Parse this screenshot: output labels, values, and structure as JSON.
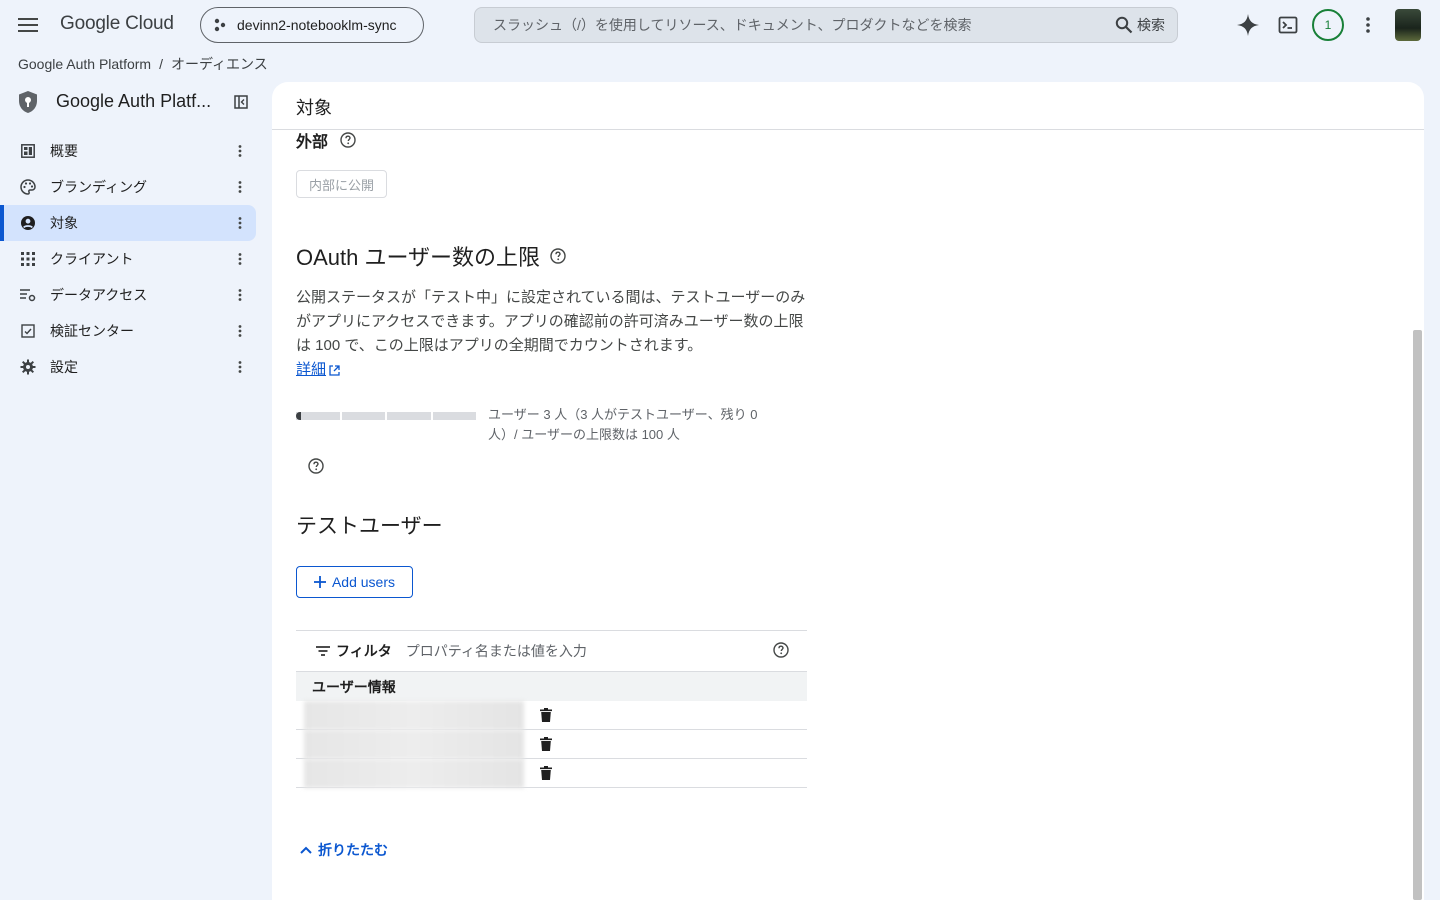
{
  "header": {
    "logo": "Google Cloud",
    "project": "devinn2-notebooklm-sync",
    "search_placeholder": "スラッシュ（/）を使用してリソース、ドキュメント、プロダクトなどを検索",
    "search_button": "検索",
    "notification_count": "1"
  },
  "breadcrumb": {
    "root": "Google Auth Platform",
    "separator": "/",
    "current": "オーディエンス"
  },
  "sidebar": {
    "product_title": "Google Auth Platf...",
    "items": [
      {
        "label": "概要",
        "icon": "dashboard-icon"
      },
      {
        "label": "ブランディング",
        "icon": "palette-icon"
      },
      {
        "label": "対象",
        "icon": "account-circle-icon",
        "active": true
      },
      {
        "label": "クライアント",
        "icon": "apps-grid-icon"
      },
      {
        "label": "データアクセス",
        "icon": "data-access-icon"
      },
      {
        "label": "検証センター",
        "icon": "verification-icon"
      },
      {
        "label": "設定",
        "icon": "gear-icon"
      }
    ]
  },
  "main": {
    "title": "対象",
    "user_type": "外部",
    "publish_button": "内部に公開",
    "oauth_limit": {
      "title": "OAuth ユーザー数の上限",
      "description": "公開ステータスが「テスト中」に設定されている間は、テストユーザーのみがアプリにアクセスできます。アプリの確認前の許可済みユーザー数の上限は 100 で、この上限はアプリの全期間でカウントされます。",
      "link": "詳細",
      "progress_fraction": 0.03,
      "progress_label": "ユーザー 3 人（3 人がテストユーザー、残り 0 人）/ ユーザーの上限数は 100 人"
    },
    "test_users": {
      "title": "テストユーザー",
      "add_button": "Add users",
      "filter_label": "フィルタ",
      "filter_placeholder": "プロパティ名または値を入力",
      "column_header": "ユーザー情報",
      "row_count": 3
    },
    "collapse": "折りたたむ"
  },
  "colors": {
    "accent": "#0b57d0",
    "active_nav": "#d3e3fd",
    "page_bg": "#eef3fb",
    "badge": "#188038"
  }
}
